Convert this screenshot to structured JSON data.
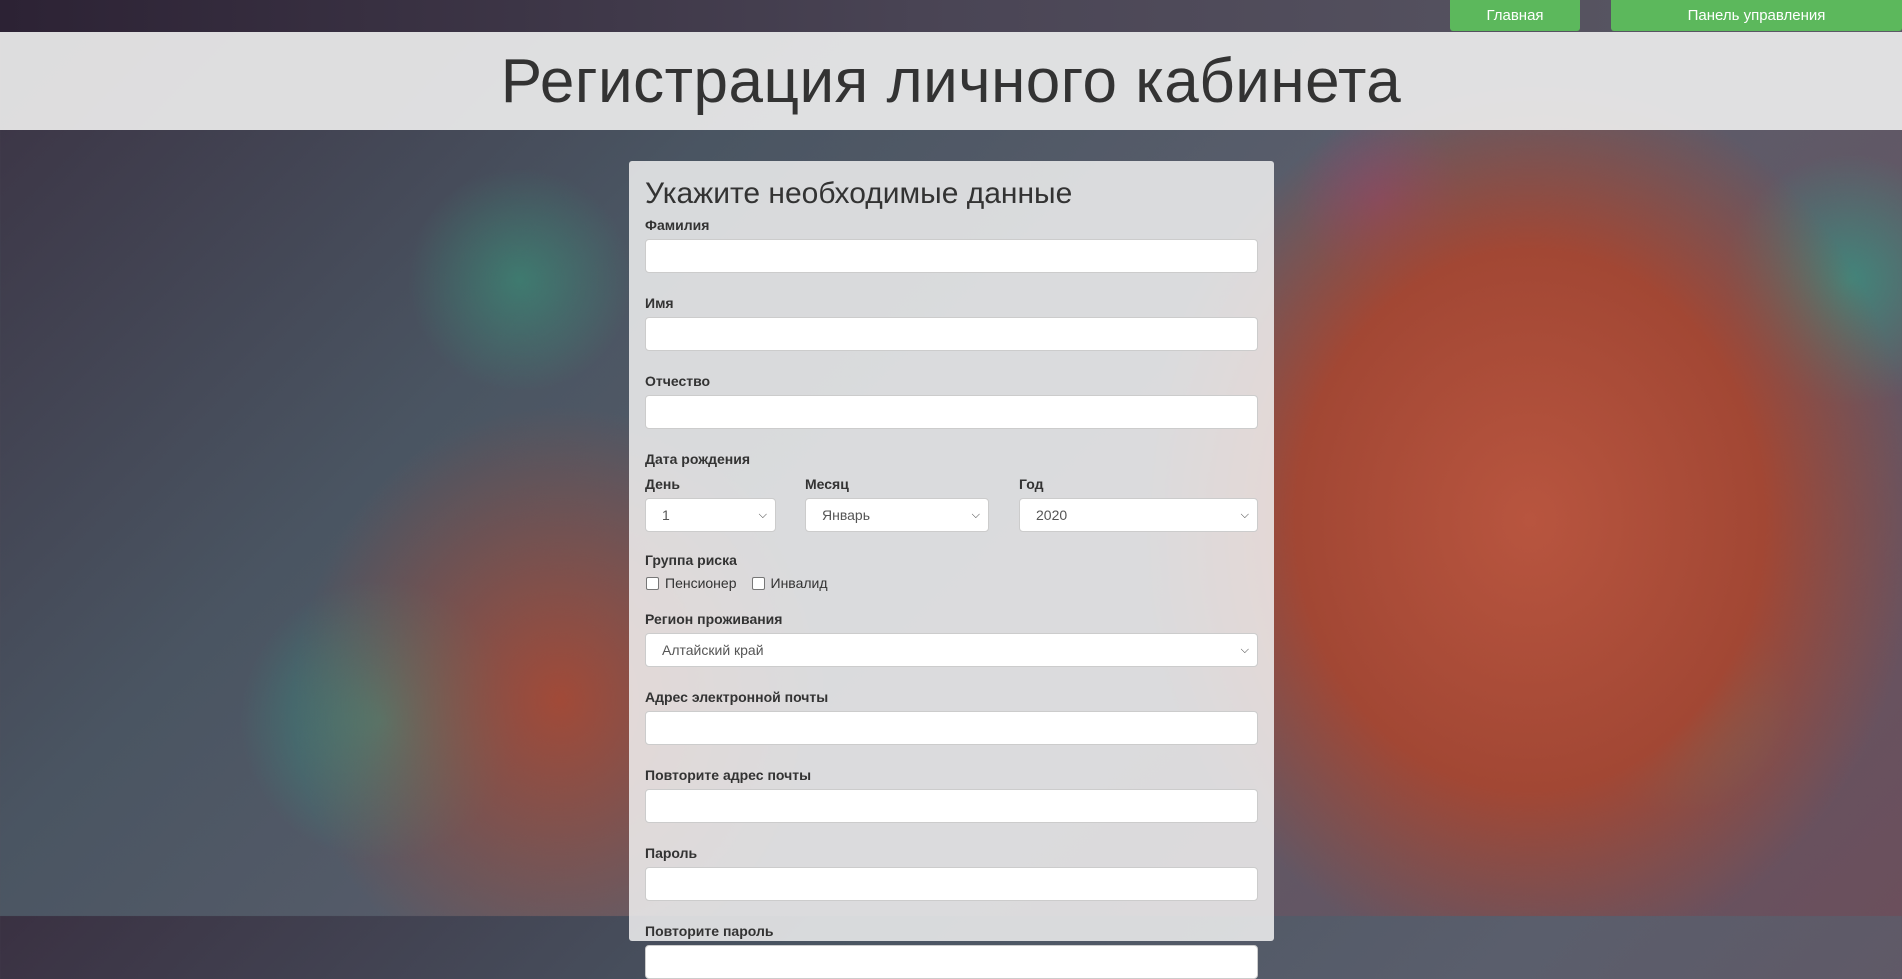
{
  "nav": {
    "home_label": "Главная",
    "panel_label": "Панель управления"
  },
  "header": {
    "title": "Регистрация личного кабинета"
  },
  "form": {
    "heading": "Укажите необходимые данные",
    "last_name_label": "Фамилия",
    "first_name_label": "Имя",
    "patronymic_label": "Отчество",
    "birth_date_label": "Дата рождения",
    "day_label": "День",
    "day_value": "1",
    "month_label": "Месяц",
    "month_value": "Январь",
    "year_label": "Год",
    "year_value": "2020",
    "risk_group_label": "Группа риска",
    "risk_pensioner": "Пенсионер",
    "risk_disabled": "Инвалид",
    "region_label": "Регион проживания",
    "region_value": "Алтайский край",
    "email_label": "Адрес электронной почты",
    "email_repeat_label": "Повторите адрес почты",
    "password_label": "Пароль",
    "password_repeat_label": "Повторите пароль"
  },
  "colors": {
    "accent_green": "#5cb85c"
  }
}
